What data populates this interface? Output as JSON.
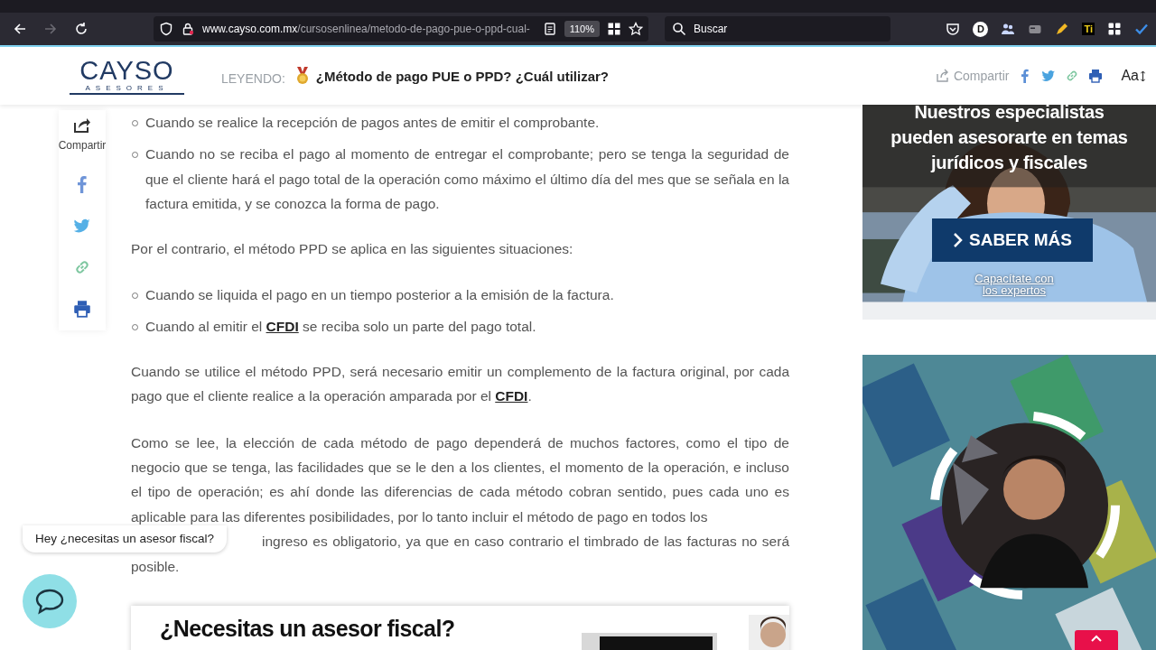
{
  "browser": {
    "nav": [
      {
        "kind": "back",
        "disabled": false
      },
      {
        "kind": "forward",
        "disabled": true
      },
      {
        "kind": "reload",
        "disabled": false
      }
    ],
    "url_host": "www.cayso.com.mx",
    "url_path": "/cursosenlinea/metodo-de-pago-pue-o-ppd-cual-",
    "zoom": "110%",
    "search_placeholder": "Buscar",
    "profile_badge": "D",
    "extension_label": "Ti"
  },
  "header": {
    "logo": "CAYSO",
    "logo_tagline": "ASESORES",
    "reading_label": "LEYENDO:",
    "title": "¿Método de pago PUE o PPD? ¿Cuál utilizar?",
    "share_label": "Compartir",
    "font_control": "Aa"
  },
  "share_rail": {
    "label": "Compartir"
  },
  "article": {
    "blocks": [
      {
        "kind": "list",
        "items": [
          [
            {
              "text": "Cuando se realice la recepción de pagos antes de emitir el comprobante."
            }
          ],
          [
            {
              "text": "Cuando no se reciba el pago al momento de entregar el comprobante; pero se tenga la seguridad de que el cliente hará el pago total de la operación como máximo el último día del mes que se señala en la factura emitida, y se conozca la forma de pago."
            }
          ]
        ]
      },
      {
        "kind": "paragraph",
        "parts": [
          {
            "text": "Por el contrario, el método PPD se aplica en las siguientes situaciones:"
          }
        ]
      },
      {
        "kind": "list",
        "items": [
          [
            {
              "text": "Cuando se liquida el pago en un tiempo posterior a la emisión de la factura."
            }
          ],
          [
            {
              "text": "Cuando al emitir el "
            },
            {
              "text": "CFDI",
              "link": true
            },
            {
              "text": " se reciba solo un parte del pago total."
            }
          ]
        ]
      },
      {
        "kind": "paragraph",
        "parts": [
          {
            "text": "Cuando se utilice el método PPD, será necesario emitir un complemento de la factura original, por cada pago que el cliente realice a la operación amparada por el "
          },
          {
            "text": "CFDI",
            "link": true
          },
          {
            "text": "."
          }
        ]
      },
      {
        "kind": "paragraph",
        "parts": [
          {
            "text": "Como se lee, la elección de cada método de pago dependerá de muchos factores, como el tipo de negocio que se tenga, las facilidades que se le den a los clientes, el momento de la operación, e incluso el tipo de operación; es ahí donde las diferencias de cada método cobran sentido, pues cada uno es aplicable para las diferentes posibilidades, por lo tanto incluir el método de pago en todos los"
          }
        ],
        "continuation": [
          "ingreso es obligatorio, ya que en caso contrario el timbrado de las facturas no será",
          "posible."
        ]
      }
    ]
  },
  "chat": {
    "prompt": "Hey ¿necesitas un asesor fiscal?"
  },
  "ad_banner": {
    "headline": "Nuestros especialistas pueden asesorarte en temas jurídicos y fiscales",
    "button": "SABER MÁS",
    "link": "Capacítate con los expertos"
  },
  "cta_card": {
    "title": "¿Necesitas un asesor fiscal?"
  }
}
